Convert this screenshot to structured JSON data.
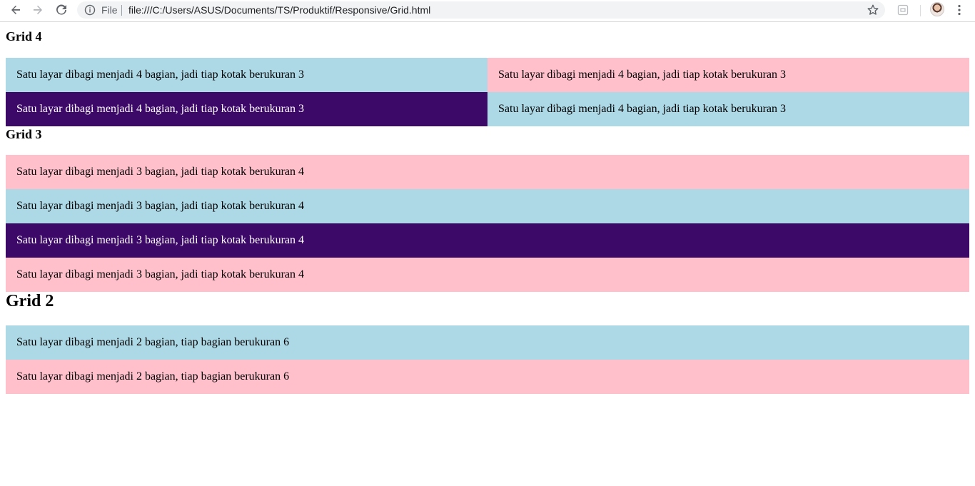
{
  "browser": {
    "scheme_label": "File",
    "url": "file:///C:/Users/ASUS/Documents/TS/Produktif/Responsive/Grid.html"
  },
  "colors": {
    "blue": "#add8e6",
    "pink": "#ffc0cb",
    "purple": "#3d0968"
  },
  "grid4": {
    "title": "Grid 4",
    "cells": [
      {
        "text": "Satu layar dibagi menjadi 4 bagian, jadi tiap kotak berukuran 3",
        "color": "blue"
      },
      {
        "text": "Satu layar dibagi menjadi 4 bagian, jadi tiap kotak berukuran 3",
        "color": "pink"
      },
      {
        "text": "Satu layar dibagi menjadi 4 bagian, jadi tiap kotak berukuran 3",
        "color": "purple"
      },
      {
        "text": "Satu layar dibagi menjadi 4 bagian, jadi tiap kotak berukuran 3",
        "color": "blue"
      }
    ]
  },
  "grid3": {
    "title": "Grid 3",
    "cells": [
      {
        "text": "Satu layar dibagi menjadi 3 bagian, jadi tiap kotak berukuran 4",
        "color": "pink"
      },
      {
        "text": "Satu layar dibagi menjadi 3 bagian, jadi tiap kotak berukuran 4",
        "color": "blue"
      },
      {
        "text": "Satu layar dibagi menjadi 3 bagian, jadi tiap kotak berukuran 4",
        "color": "purple"
      },
      {
        "text": "Satu layar dibagi menjadi 3 bagian, jadi tiap kotak berukuran 4",
        "color": "pink"
      }
    ]
  },
  "grid2": {
    "title": "Grid 2",
    "cells": [
      {
        "text": "Satu layar dibagi menjadi 2 bagian, tiap bagian berukuran 6",
        "color": "blue"
      },
      {
        "text": "Satu layar dibagi menjadi 2 bagian, tiap bagian berukuran 6",
        "color": "pink"
      }
    ]
  }
}
